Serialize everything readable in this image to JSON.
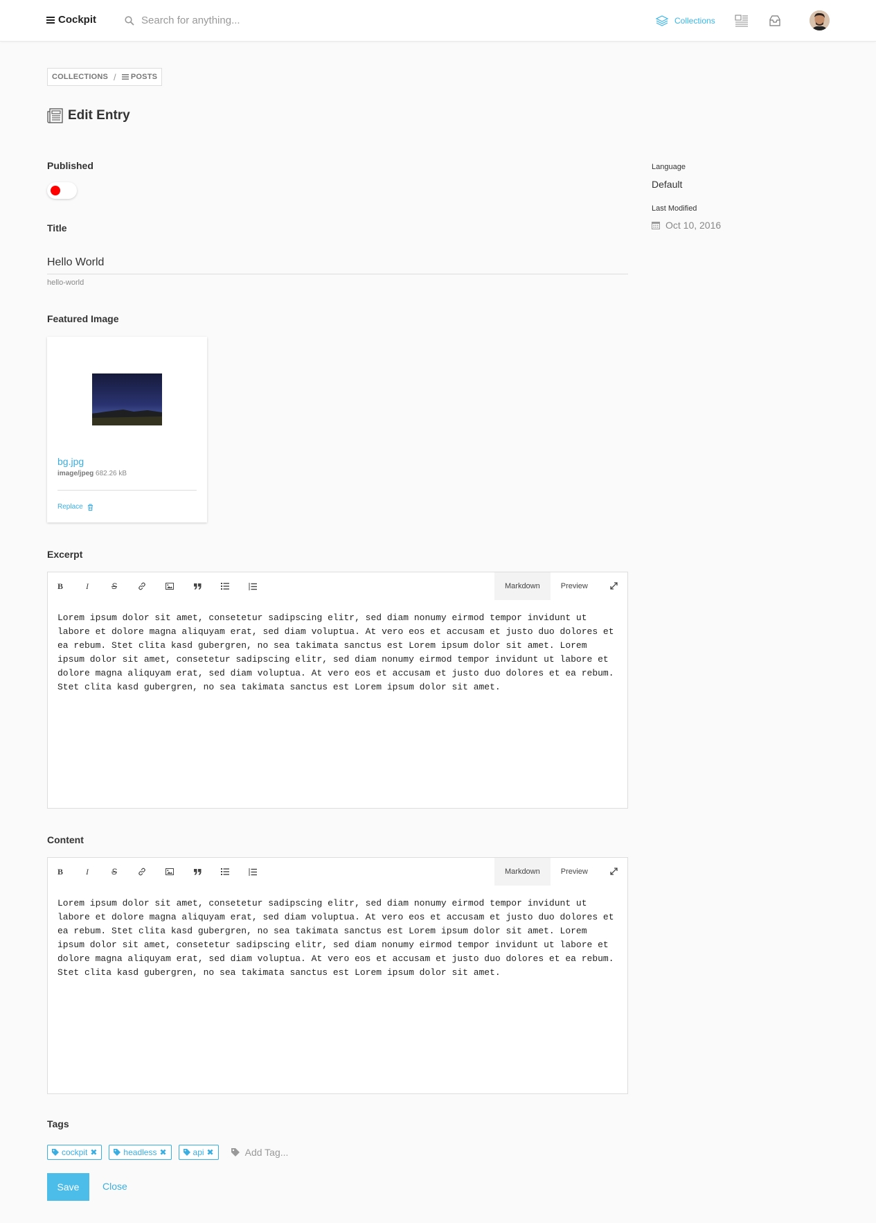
{
  "header": {
    "brand": "Cockpit",
    "search_placeholder": "Search for anything...",
    "nav_collections": "Collections",
    "accent_color": "#38b6e8"
  },
  "breadcrumb": {
    "collections": "COLLECTIONS",
    "separator": "/",
    "posts": "POSTS"
  },
  "page": {
    "title": "Edit Entry"
  },
  "form": {
    "published": {
      "label": "Published",
      "enabled": false,
      "indicator_color": "#ff0000"
    },
    "title": {
      "label": "Title",
      "value": "Hello World",
      "slug": "hello-world"
    },
    "featured_image": {
      "label": "Featured Image",
      "filename": "bg.jpg",
      "mime": "image/jpeg",
      "size": "682.26 kB",
      "replace_label": "Replace"
    },
    "excerpt": {
      "label": "Excerpt",
      "tab_markdown": "Markdown",
      "tab_preview": "Preview",
      "text": "Lorem ipsum dolor sit amet, consetetur sadipscing elitr, sed diam nonumy eirmod tempor invidunt ut labore et dolore magna aliquyam erat, sed diam voluptua. At vero eos et accusam et justo duo dolores et ea rebum. Stet clita kasd gubergren, no sea takimata sanctus est Lorem ipsum dolor sit amet. Lorem ipsum dolor sit amet, consetetur sadipscing elitr, sed diam nonumy eirmod tempor invidunt ut labore et dolore magna aliquyam erat, sed diam voluptua. At vero eos et accusam et justo duo dolores et ea rebum. Stet clita kasd gubergren, no sea takimata sanctus est Lorem ipsum dolor sit amet."
    },
    "content": {
      "label": "Content",
      "tab_markdown": "Markdown",
      "tab_preview": "Preview",
      "text": "Lorem ipsum dolor sit amet, consetetur sadipscing elitr, sed diam nonumy eirmod tempor invidunt ut labore et dolore magna aliquyam erat, sed diam voluptua. At vero eos et accusam et justo duo dolores et ea rebum. Stet clita kasd gubergren, no sea takimata sanctus est Lorem ipsum dolor sit amet. Lorem ipsum dolor sit amet, consetetur sadipscing elitr, sed diam nonumy eirmod tempor invidunt ut labore et dolore magna aliquyam erat, sed diam voluptua. At vero eos et accusam et justo duo dolores et ea rebum. Stet clita kasd gubergren, no sea takimata sanctus est Lorem ipsum dolor sit amet."
    },
    "toolbar": {
      "bold": "B",
      "italic": "I",
      "strike": "S"
    },
    "tags": {
      "label": "Tags",
      "items": [
        "cockpit",
        "headless",
        "api"
      ],
      "add_placeholder": "Add Tag..."
    },
    "save_label": "Save",
    "close_label": "Close"
  },
  "sidebar": {
    "language_label": "Language",
    "language_value": "Default",
    "modified_label": "Last Modified",
    "modified_value": "Oct 10, 2016"
  }
}
